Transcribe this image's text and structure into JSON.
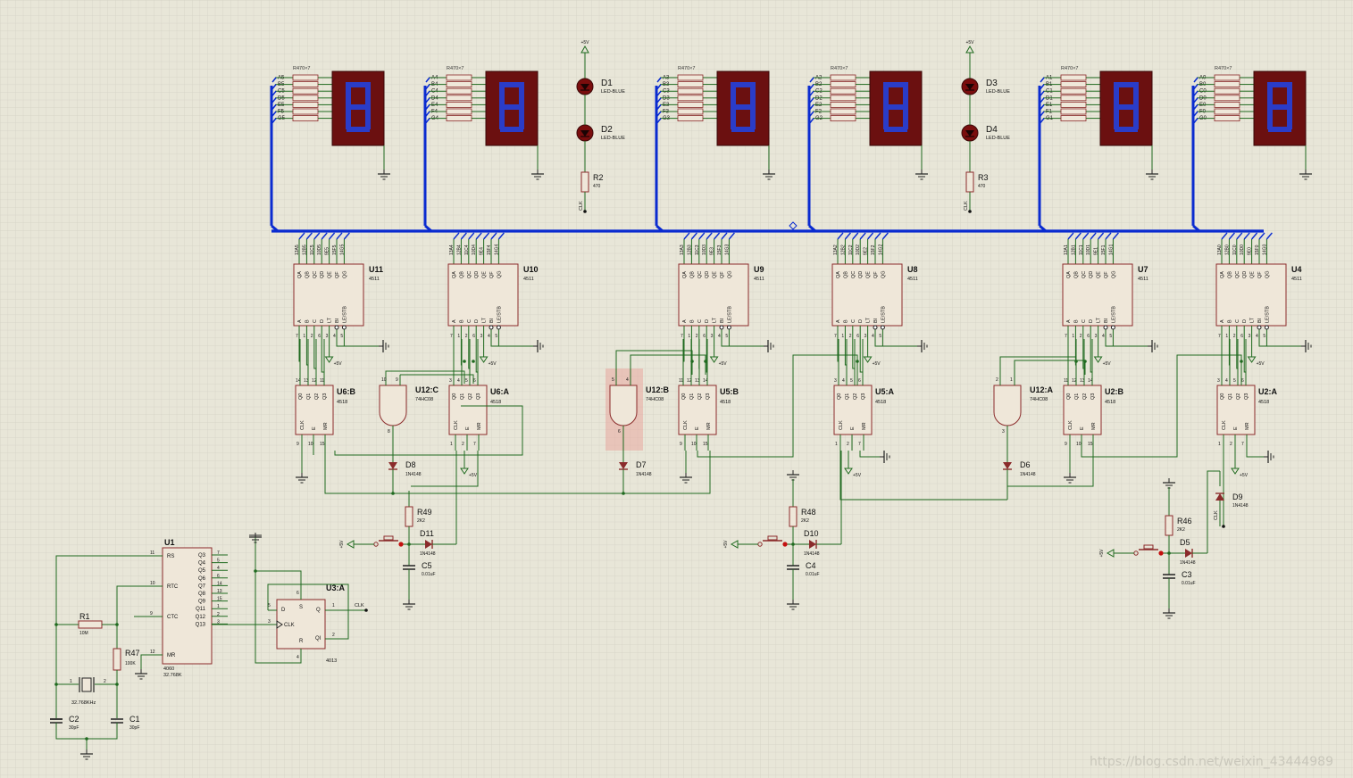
{
  "colors": {
    "grid": "#cfcdbf",
    "wire": "#1f6a1f",
    "bus": "#0a2bd0",
    "component": "#8b2b2b",
    "ic_fill": "#efe7d9",
    "display_bg": "#6b1010",
    "segment": "#2a3cc8",
    "led": "#7a0d0d"
  },
  "displays": [
    {
      "ref": "R470×7",
      "pins": [
        "A5",
        "B5",
        "C5",
        "D5",
        "E5",
        "F5",
        "G5"
      ]
    },
    {
      "ref": "R470×7",
      "pins": [
        "A4",
        "B4",
        "C4",
        "D4",
        "E4",
        "F4",
        "G4"
      ]
    },
    {
      "ref": "R470×7",
      "pins": [
        "A3",
        "B3",
        "C3",
        "D3",
        "E3",
        "F3",
        "G3"
      ]
    },
    {
      "ref": "R470×7",
      "pins": [
        "A2",
        "B2",
        "C2",
        "D2",
        "E2",
        "F2",
        "G2"
      ]
    },
    {
      "ref": "R470×7",
      "pins": [
        "A1",
        "B1",
        "C1",
        "D1",
        "E1",
        "F1",
        "G1"
      ]
    },
    {
      "ref": "R470×7",
      "pins": [
        "A0",
        "B0",
        "C0",
        "D0",
        "E0",
        "F0",
        "G0"
      ]
    }
  ],
  "leds": [
    {
      "d1": "D1",
      "d2": "D2",
      "type": "LED-BLUE",
      "res": "R2",
      "val": "470",
      "supply": "+5V",
      "clk": "CLK"
    },
    {
      "d1": "D3",
      "d2": "D4",
      "type": "LED-BLUE",
      "res": "R3",
      "val": "470",
      "supply": "+5V",
      "clk": "CLK"
    }
  ],
  "decoders": [
    {
      "ref": "U11",
      "part": "4511",
      "top": [
        "13A5",
        "12B5",
        "11C5",
        "10D5",
        "9E5",
        "15F5",
        "14G5"
      ]
    },
    {
      "ref": "U10",
      "part": "4511",
      "top": [
        "13A4",
        "12B4",
        "11C4",
        "10D4",
        "9E4",
        "15F4",
        "14G4"
      ]
    },
    {
      "ref": "U9",
      "part": "4511",
      "top": [
        "13A3",
        "12B3",
        "11C3",
        "10D3",
        "9E3",
        "15F3",
        "14G3"
      ]
    },
    {
      "ref": "U8",
      "part": "4511",
      "top": [
        "13A2",
        "12B2",
        "11C2",
        "10D2",
        "9E2",
        "15F2",
        "14G2"
      ]
    },
    {
      "ref": "U7",
      "part": "4511",
      "top": [
        "13A1",
        "12B1",
        "11C1",
        "10D1",
        "9E1",
        "15F1",
        "14G1"
      ]
    },
    {
      "ref": "U4",
      "part": "4511",
      "top": [
        "13A0",
        "12B0",
        "11C0",
        "10D0",
        "9E0",
        "15F0",
        "14G0"
      ]
    }
  ],
  "decoder_pins": {
    "outputs": [
      "QA",
      "QB",
      "QC",
      "QD",
      "QE",
      "QF",
      "QG"
    ],
    "inputs": [
      "A",
      "B",
      "C",
      "D",
      "LT",
      "BI",
      "LE/STB"
    ],
    "numbers": [
      "7",
      "1",
      "2",
      "6",
      "3",
      "4",
      "5"
    ]
  },
  "counters": [
    {
      "ref": "U6:B",
      "part": "4518",
      "pins": [
        "14",
        "13",
        "12",
        "11"
      ],
      "bot": [
        "9",
        "10",
        "15"
      ]
    },
    {
      "ref": "U6:A",
      "part": "4518",
      "pins": [
        "3",
        "4",
        "5",
        "6"
      ],
      "bot": [
        "1",
        "2",
        "7"
      ]
    },
    {
      "ref": "U5:B",
      "part": "4518",
      "pins": [
        "11",
        "12",
        "13",
        "14"
      ],
      "bot": [
        "9",
        "10",
        "15"
      ]
    },
    {
      "ref": "U5:A",
      "part": "4518",
      "pins": [
        "3",
        "4",
        "5",
        "6"
      ],
      "bot": [
        "1",
        "2",
        "7"
      ]
    },
    {
      "ref": "U2:B",
      "part": "4518",
      "pins": [
        "11",
        "12",
        "13",
        "14"
      ],
      "bot": [
        "9",
        "10",
        "15"
      ]
    },
    {
      "ref": "U2:A",
      "part": "4518",
      "pins": [
        "3",
        "4",
        "5",
        "6"
      ],
      "bot": [
        "1",
        "2",
        "7"
      ]
    }
  ],
  "counter_pins": {
    "q": [
      "Q0",
      "Q1",
      "Q2",
      "Q3"
    ],
    "bot": [
      "CLK",
      "E",
      "MR"
    ]
  },
  "gates": [
    {
      "ref": "U12:C",
      "part": "74HC08",
      "pins": [
        "10",
        "9",
        "8"
      ]
    },
    {
      "ref": "U12:B",
      "part": "74HC08",
      "pins": [
        "5",
        "4",
        "6"
      ]
    },
    {
      "ref": "U12:A",
      "part": "74HC08",
      "pins": [
        "2",
        "1",
        "3"
      ]
    }
  ],
  "diodes": [
    {
      "ref": "D8",
      "type": "1N4148"
    },
    {
      "ref": "D7",
      "type": "1N4148"
    },
    {
      "ref": "D6",
      "type": "1N4148"
    },
    {
      "ref": "D11",
      "type": "1N4148"
    },
    {
      "ref": "D10",
      "type": "1N4148"
    },
    {
      "ref": "D5",
      "type": "1N4148"
    },
    {
      "ref": "D9",
      "type": "1N4148"
    }
  ],
  "debounce": [
    {
      "res": "R49",
      "rval": "2K2",
      "cap": "C5",
      "cval": "0.01uF"
    },
    {
      "res": "R48",
      "rval": "2K2",
      "cap": "C4",
      "cval": "0.01uF"
    },
    {
      "res": "R46",
      "rval": "2K2",
      "cap": "C3",
      "cval": "0.01uF"
    }
  ],
  "labels": {
    "vcc": "+5V",
    "clk": "CLK"
  },
  "osc": {
    "ref": "U1",
    "part": "4060",
    "freq": "32.768K",
    "left_pins": [
      {
        "n": "11",
        "name": "RS"
      },
      {
        "n": "10",
        "name": "RTC"
      },
      {
        "n": "9",
        "name": "CTC"
      },
      {
        "n": "12",
        "name": "MR"
      }
    ],
    "right_pins": [
      {
        "n": "7",
        "name": "Q3"
      },
      {
        "n": "5",
        "name": "Q4"
      },
      {
        "n": "4",
        "name": "Q5"
      },
      {
        "n": "6",
        "name": "Q6"
      },
      {
        "n": "14",
        "name": "Q7"
      },
      {
        "n": "13",
        "name": "Q8"
      },
      {
        "n": "15",
        "name": "Q9"
      },
      {
        "n": "1",
        "name": "Q11"
      },
      {
        "n": "2",
        "name": "Q12"
      },
      {
        "n": "3",
        "name": "Q13"
      }
    ],
    "r1": "R1",
    "r1v": "10M",
    "r47": "R47",
    "r47v": "100K",
    "xtal": "32.768KHz",
    "c2": "C2",
    "c2v": "30pF",
    "c1": "C1",
    "c1v": "30pF"
  },
  "ff": {
    "ref": "U3:A",
    "part": "4013",
    "pins": {
      "D": "D",
      "S": "S",
      "CLK": "CLK",
      "R": "R",
      "Q": "Q",
      "QI": "QI"
    },
    "nums": [
      "5",
      "6",
      "3",
      "4",
      "1",
      "2"
    ]
  },
  "watermark": "https://blog.csdn.net/weixin_43444989"
}
